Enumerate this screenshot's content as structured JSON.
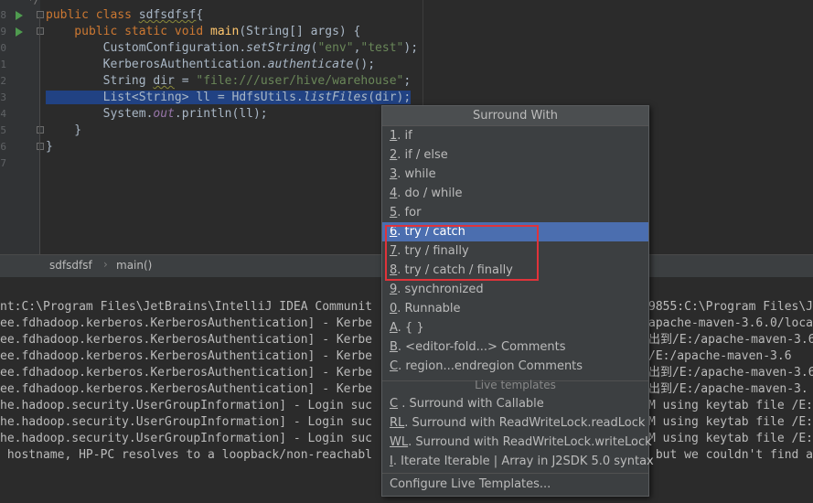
{
  "editor": {
    "lines": [
      {
        "num": "8",
        "text_parts": [
          [
            "kw",
            "public class "
          ],
          [
            "sq",
            "sdfsdfsf"
          ],
          [
            "",
            "{"
          ]
        ]
      },
      {
        "num": "9",
        "text_parts": [
          [
            "kw",
            "    public static void "
          ],
          [
            "fn",
            "main"
          ],
          [
            "",
            "(String[] args) {"
          ]
        ]
      },
      {
        "num": "0",
        "text_parts": [
          [
            "",
            "        CustomConfiguration."
          ],
          [
            "it",
            "setString"
          ],
          [
            "",
            "("
          ],
          [
            "str",
            "\"env\""
          ],
          [
            "",
            ","
          ],
          [
            "str",
            "\"test\""
          ],
          [
            "",
            ");"
          ]
        ]
      },
      {
        "num": "1",
        "text_parts": [
          [
            "",
            "        KerberosAuthentication."
          ],
          [
            "it",
            "authenticate"
          ],
          [
            "",
            "();"
          ]
        ]
      },
      {
        "num": "2",
        "text_parts": [
          [
            "",
            "        String "
          ],
          [
            "sq",
            "dir"
          ],
          [
            "",
            " = "
          ],
          [
            "str",
            "\"file:///user/hive/warehouse\""
          ],
          [
            "",
            ";"
          ]
        ]
      },
      {
        "num": "3",
        "text_parts": [
          [
            "sel",
            "        List<String> ll = HdfsUtils."
          ],
          [
            "selit",
            "listFiles"
          ],
          [
            "sel",
            "(dir);"
          ]
        ]
      },
      {
        "num": "4",
        "text_parts": [
          [
            "",
            "        System."
          ],
          [
            "stat",
            "out"
          ],
          [
            "",
            ".println(ll);"
          ]
        ]
      },
      {
        "num": "5",
        "text_parts": [
          [
            "",
            "    }"
          ]
        ]
      },
      {
        "num": "6",
        "text_parts": [
          [
            "",
            "}"
          ]
        ]
      },
      {
        "num": "7",
        "text_parts": []
      }
    ]
  },
  "breadcrumb": {
    "class": "sdfsdfsf",
    "sep": "›",
    "method": "main()"
  },
  "console": {
    "lines": [
      {
        "left": "nt:C:\\Program Files\\JetBrains\\IntelliJ IDEA Communit",
        "right": "9855:C:\\Program Files\\J"
      },
      {
        "left": "ee.fdhadoop.kerberos.KerberosAuthentication] - Kerbe",
        "right": "apache-maven-3.6.0/loca"
      },
      {
        "left": "ee.fdhadoop.kerberos.KerberosAuthentication] - Kerbe",
        "right": "出到/E:/apache-maven-3.6"
      },
      {
        "left": "ee.fdhadoop.kerberos.KerberosAuthentication] - Kerbe",
        "right": "/E:/apache-maven-3.6"
      },
      {
        "left": "ee.fdhadoop.kerberos.KerberosAuthentication] - Kerbe",
        "right": "出到/E:/apache-maven-3.6"
      },
      {
        "left": "ee.fdhadoop.kerberos.KerberosAuthentication] - Kerbe",
        "right": "出到/E:/apache-maven-3."
      },
      {
        "left": "he.hadoop.security.UserGroupInformation] - Login suc",
        "right": "M using keytab file /E:"
      },
      {
        "left": "he.hadoop.security.UserGroupInformation] - Login suc",
        "right": "M using keytab file /E:"
      },
      {
        "left": "he.hadoop.security.UserGroupInformation] - Login suc",
        "right": "M using keytab file /E:"
      },
      {
        "left": " hostname, HP-PC resolves to a loopback/non-reachabl",
        "right": " but we couldn't find a"
      }
    ]
  },
  "popup": {
    "title": "Surround With",
    "items": [
      {
        "mn": "1",
        "label": ". if"
      },
      {
        "mn": "2",
        "label": ". if / else"
      },
      {
        "mn": "3",
        "label": ". while"
      },
      {
        "mn": "4",
        "label": ". do / while"
      },
      {
        "mn": "5",
        "label": ". for"
      },
      {
        "mn": "6",
        "label": ". try / catch",
        "active": true
      },
      {
        "mn": "7",
        "label": ". try / finally"
      },
      {
        "mn": "8",
        "label": ". try / catch / finally"
      },
      {
        "mn": "9",
        "label": ". synchronized"
      },
      {
        "mn": "0",
        "label": ". Runnable"
      },
      {
        "mn": "A",
        "label": ". { }"
      },
      {
        "mn": "B",
        "label": ". <editor-fold...> Comments"
      },
      {
        "mn": "C",
        "label": ". region...endregion Comments"
      }
    ],
    "section_label": "Live templates",
    "live_items": [
      {
        "mn": "C",
        "label": " . Surround with Callable"
      },
      {
        "mn": "RL",
        "label": ". Surround with ReadWriteLock.readLock"
      },
      {
        "mn": "WL",
        "label": ". Surround with ReadWriteLock.writeLock"
      },
      {
        "mn": "I",
        "label": ". Iterate Iterable | Array in J2SDK 5.0 syntax"
      }
    ],
    "configure_label": "Configure Live Templates..."
  },
  "colors": {
    "selection_active": "#4b6eaf",
    "highlight_box": "#e0333a"
  }
}
